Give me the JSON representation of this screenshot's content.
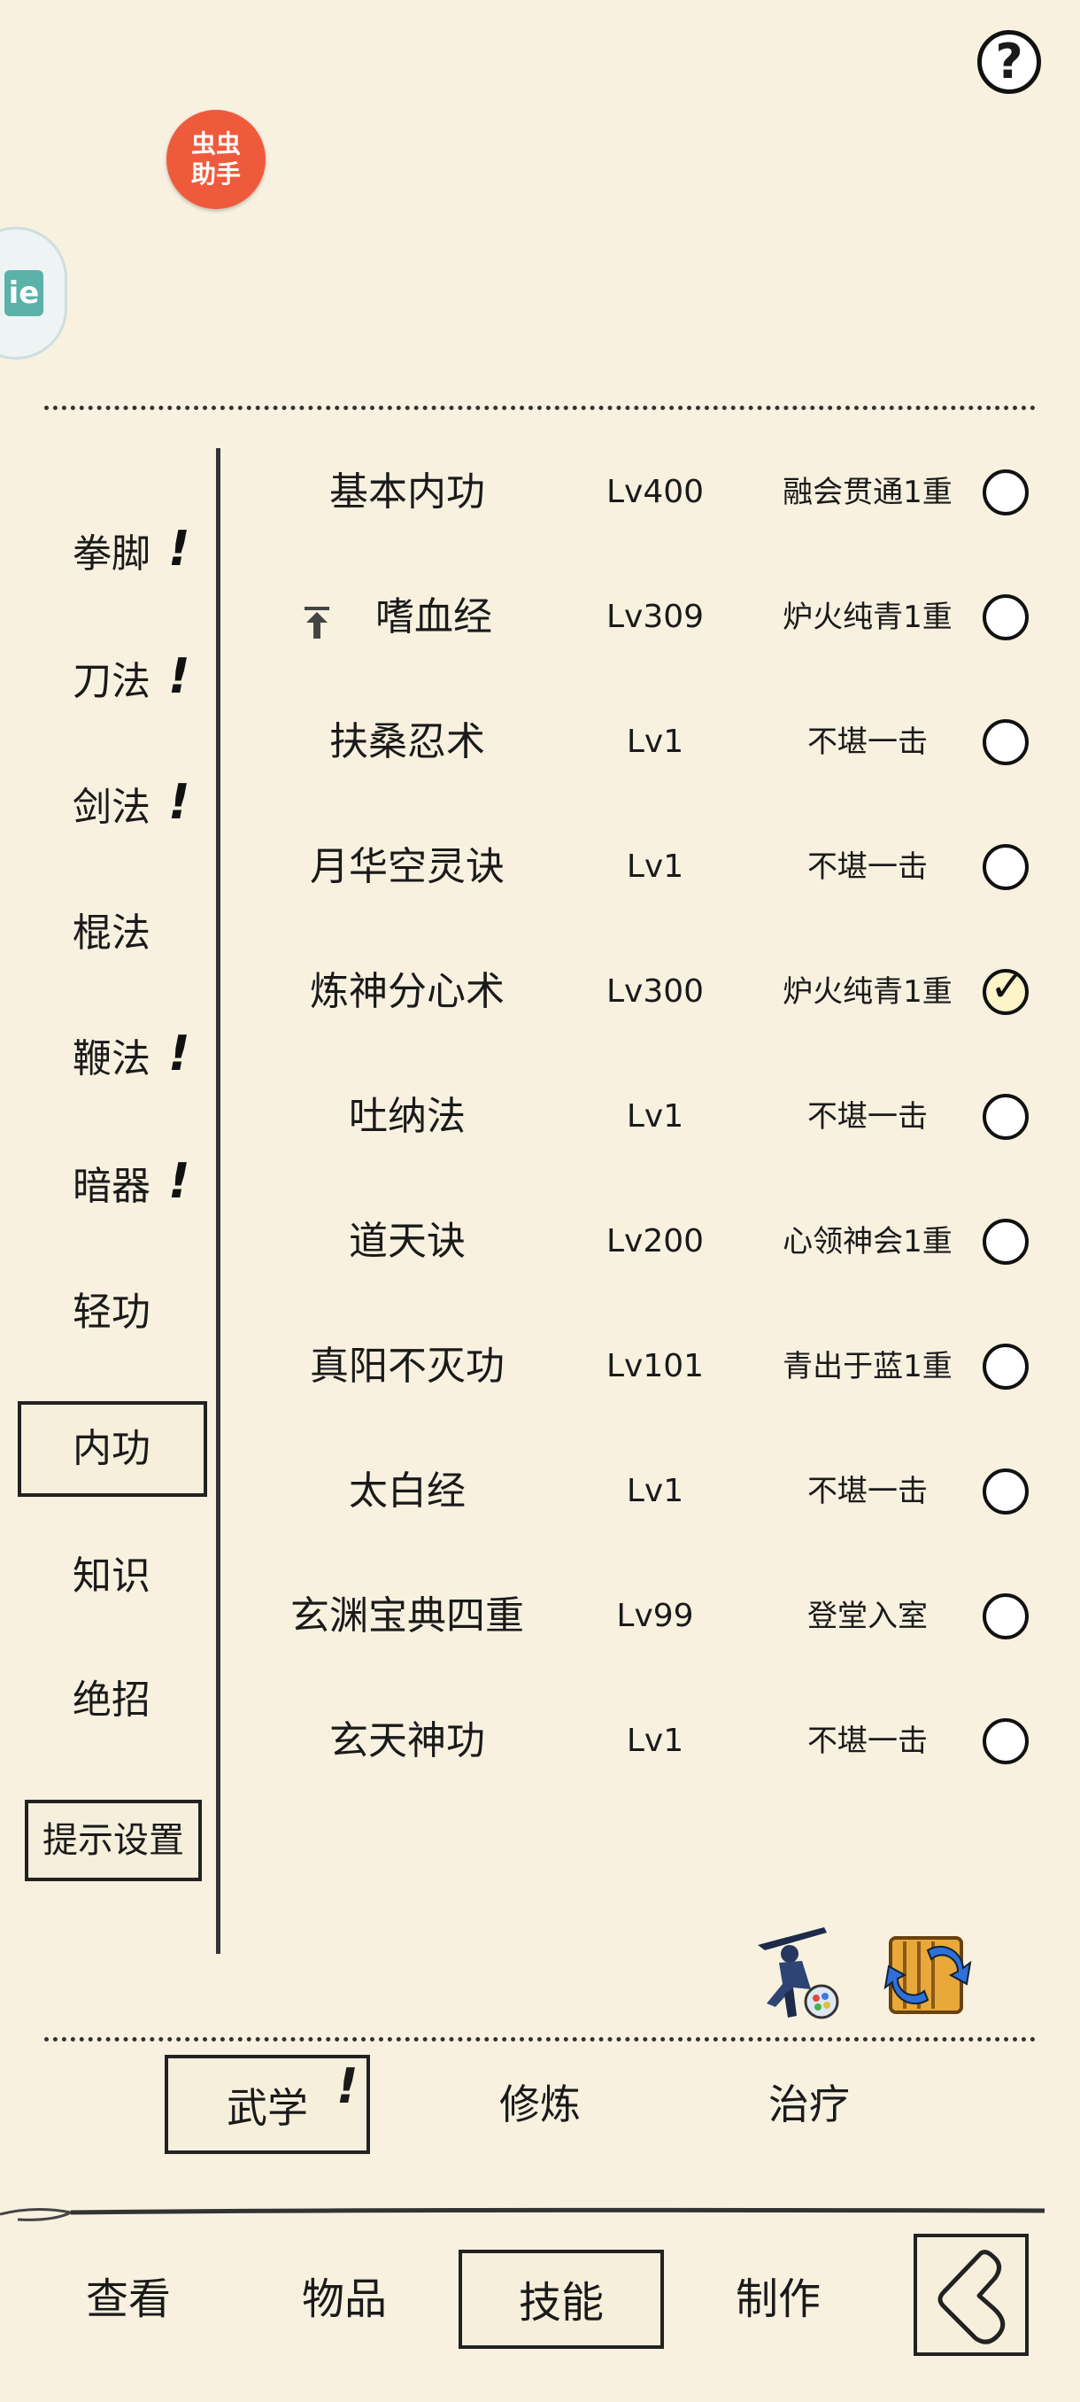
{
  "top": {
    "help_label": "?",
    "badge_line1": "虫虫",
    "badge_line2": "助手",
    "float_glyph": "ie"
  },
  "categories": [
    {
      "label": "拳脚",
      "mark": "!"
    },
    {
      "label": "刀法",
      "mark": "!"
    },
    {
      "label": "剑法",
      "mark": "!"
    },
    {
      "label": "棍法",
      "mark": ""
    },
    {
      "label": "鞭法",
      "mark": "!"
    },
    {
      "label": "暗器",
      "mark": "!"
    },
    {
      "label": "轻功",
      "mark": ""
    },
    {
      "label": "内功",
      "mark": "",
      "selected": true
    },
    {
      "label": "知识",
      "mark": ""
    },
    {
      "label": "绝招",
      "mark": ""
    }
  ],
  "hint_settings": "提示设置",
  "skills": [
    {
      "name": "基本内功",
      "level": "Lv400",
      "rank": "融会贯通1重",
      "checked": false,
      "arrow": false
    },
    {
      "name": "嗜血经",
      "level": "Lv309",
      "rank": "炉火纯青1重",
      "checked": false,
      "arrow": true
    },
    {
      "name": "扶桑忍术",
      "level": "Lv1",
      "rank": "不堪一击",
      "checked": false,
      "arrow": false
    },
    {
      "name": "月华空灵诀",
      "level": "Lv1",
      "rank": "不堪一击",
      "checked": false,
      "arrow": false
    },
    {
      "name": "炼神分心术",
      "level": "Lv300",
      "rank": "炉火纯青1重",
      "checked": true,
      "arrow": false
    },
    {
      "name": "吐纳法",
      "level": "Lv1",
      "rank": "不堪一击",
      "checked": false,
      "arrow": false
    },
    {
      "name": "道天诀",
      "level": "Lv200",
      "rank": "心领神会1重",
      "checked": false,
      "arrow": false
    },
    {
      "name": "真阳不灭功",
      "level": "Lv101",
      "rank": "青出于蓝1重",
      "checked": false,
      "arrow": false
    },
    {
      "name": "太白经",
      "level": "Lv1",
      "rank": "不堪一击",
      "checked": false,
      "arrow": false
    },
    {
      "name": "玄渊宝典四重",
      "level": "Lv99",
      "rank": "登堂入室",
      "checked": false,
      "arrow": false
    },
    {
      "name": "玄天神功",
      "level": "Lv1",
      "rank": "不堪一击",
      "checked": false,
      "arrow": false
    }
  ],
  "subtabs": {
    "wuxue": "武学",
    "wuxue_mark": "!",
    "xiulian": "修炼",
    "zhiliao": "治疗"
  },
  "bottom_nav": {
    "view": "查看",
    "items": "物品",
    "skills": "技能",
    "craft": "制作"
  }
}
